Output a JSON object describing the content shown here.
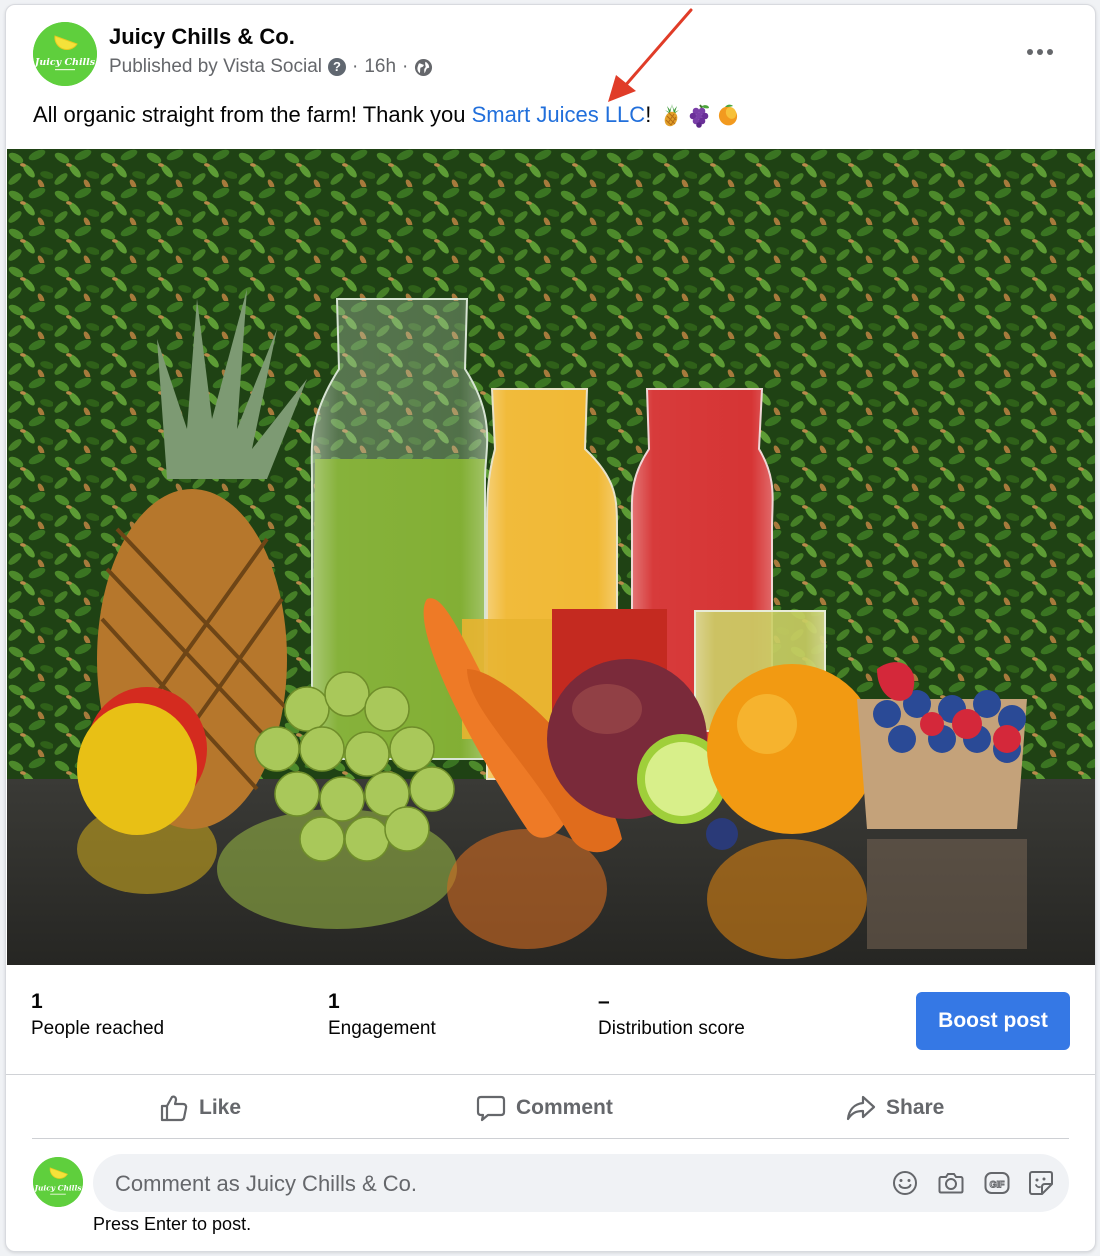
{
  "post": {
    "page_name": "Juicy Chills & Co.",
    "published_by": "Published by Vista Social",
    "separator": "·",
    "time": "16h",
    "caption_before": "All organic straight from the farm! Thank you ",
    "caption_link": "Smart Juices LLC",
    "caption_after": "!",
    "emojis": [
      "pineapple",
      "grapes",
      "mango"
    ],
    "avatar_text": "Juicy Chills"
  },
  "stats": [
    {
      "value": "1",
      "label": "People reached"
    },
    {
      "value": "1",
      "label": "Engagement"
    },
    {
      "value": "–",
      "label": "Distribution score"
    }
  ],
  "boost_label": "Boost post",
  "actions": {
    "like": "Like",
    "comment": "Comment",
    "share": "Share"
  },
  "comment": {
    "placeholder": "Comment as Juicy Chills & Co.",
    "hint": "Press Enter to post.",
    "icons": [
      "emoji-icon",
      "camera-icon",
      "gif-icon",
      "sticker-icon"
    ]
  },
  "colors": {
    "link": "#216fdb",
    "boost": "#3578e5",
    "avatar_green": "#5fcf3d",
    "annotation_arrow": "#e03c28"
  }
}
